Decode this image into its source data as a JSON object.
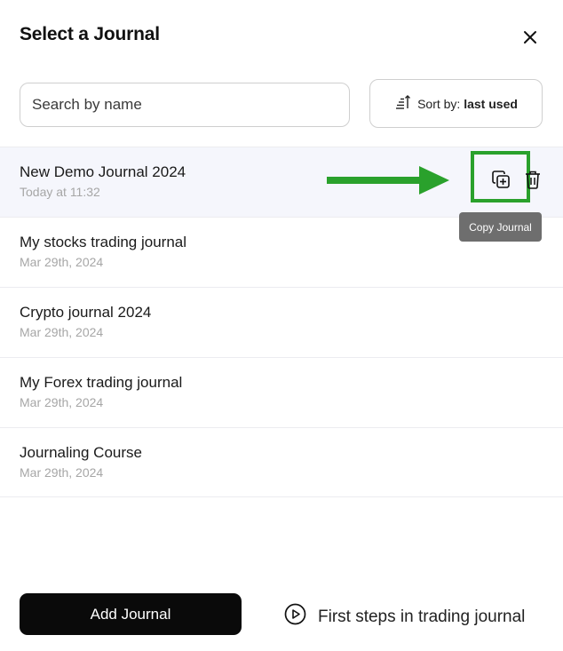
{
  "dialog": {
    "title": "Select a Journal"
  },
  "search": {
    "placeholder": "Search by name"
  },
  "sort": {
    "label": "Sort by:",
    "value": "last used"
  },
  "journals": [
    {
      "name": "New Demo Journal 2024",
      "date": "Today at 11:32"
    },
    {
      "name": "My stocks trading journal",
      "date": "Mar 29th, 2024"
    },
    {
      "name": "Crypto journal 2024",
      "date": "Mar 29th, 2024"
    },
    {
      "name": "My Forex trading journal",
      "date": "Mar 29th, 2024"
    },
    {
      "name": "Journaling Course",
      "date": "Mar 29th, 2024"
    }
  ],
  "tooltip": {
    "text": "Copy Journal"
  },
  "footer": {
    "add_label": "Add Journal",
    "first_steps_label": "First steps in trading journal"
  },
  "colors": {
    "annotation_green": "#2aa12c",
    "selected_row_bg": "#f5f6fc",
    "primary_button": "#0a0a0a"
  }
}
